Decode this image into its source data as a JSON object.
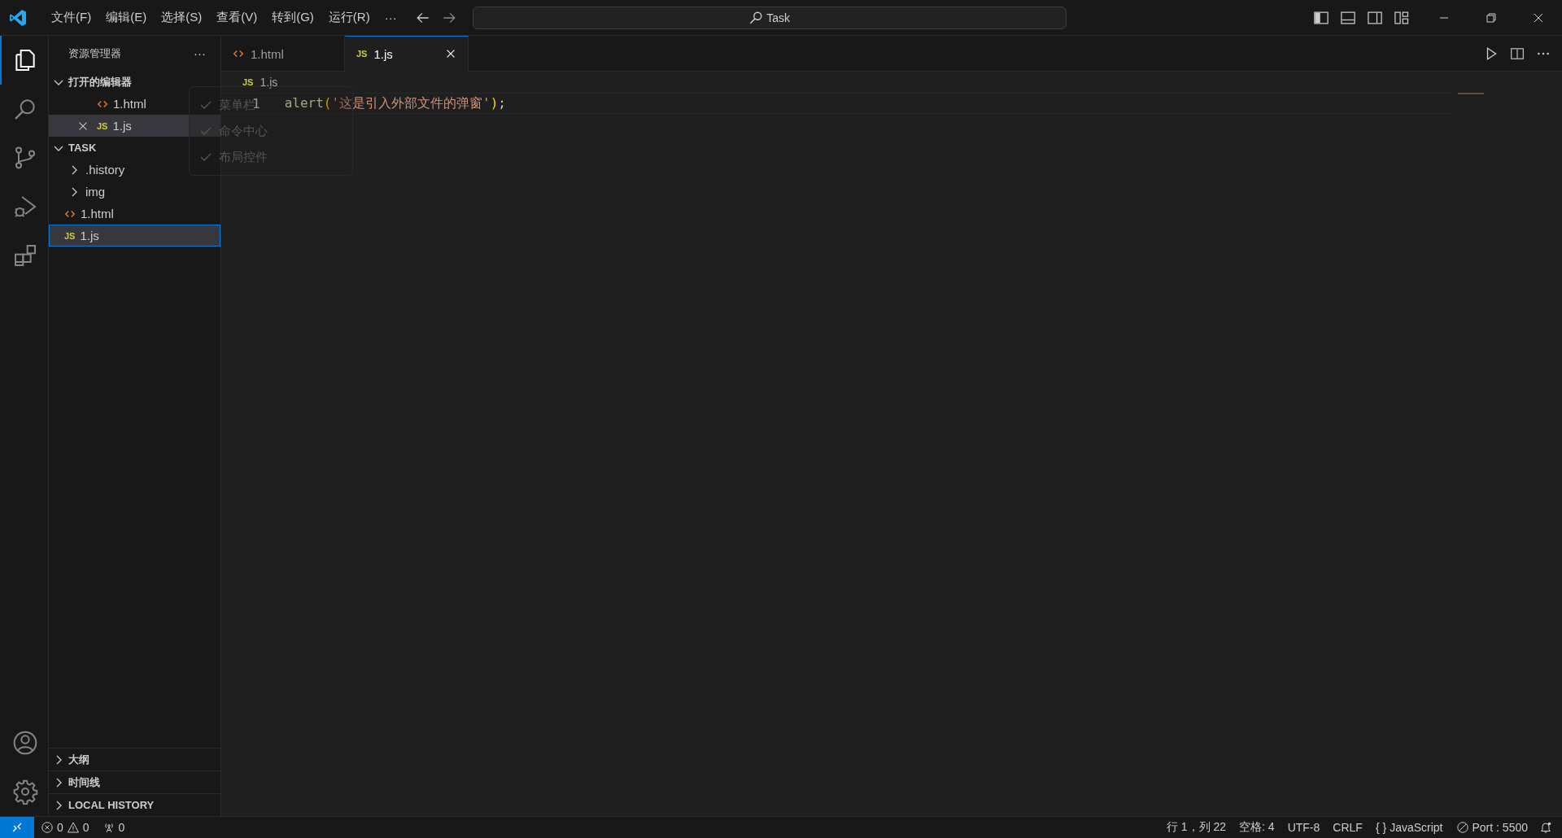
{
  "menu_bar": {
    "items": [
      "文件(F)",
      "编辑(E)",
      "选择(S)",
      "查看(V)",
      "转到(G)",
      "运行(R)"
    ],
    "overflow": "···"
  },
  "command_center": {
    "text": "Task"
  },
  "activity_bar": {
    "top": [
      {
        "kind": "explorer",
        "selected": true
      },
      {
        "kind": "search",
        "selected": false
      },
      {
        "kind": "source-control",
        "selected": false
      },
      {
        "kind": "run-debug",
        "selected": false
      },
      {
        "kind": "extensions",
        "selected": false
      }
    ],
    "bottom": [
      {
        "kind": "account"
      },
      {
        "kind": "settings"
      }
    ]
  },
  "sidebar": {
    "title": "资源管理器",
    "more": "···",
    "sections": [
      {
        "title": "打开的编辑器",
        "expanded": true,
        "items": [
          {
            "name": "1.html",
            "kind": "html",
            "selected": false,
            "closable": false
          },
          {
            "name": "1.js",
            "kind": "js",
            "badge": "JS",
            "selected": true,
            "closable": true
          }
        ]
      },
      {
        "title": "TASK",
        "expanded": true,
        "items": [
          {
            "name": ".history",
            "kind": "folder",
            "expanded": false,
            "selected": false
          },
          {
            "name": "img",
            "kind": "folder",
            "expanded": false,
            "selected": false
          },
          {
            "name": "1.html",
            "kind": "html",
            "selected": false
          },
          {
            "name": "1.js",
            "kind": "js",
            "badge": "JS",
            "selected": true
          }
        ]
      }
    ],
    "bottom_sections": [
      {
        "title": "大纲",
        "expanded": false
      },
      {
        "title": "时间线",
        "expanded": false
      },
      {
        "title": "LOCAL HISTORY",
        "expanded": false
      }
    ]
  },
  "tabs": [
    {
      "label": "1.html",
      "kind": "html",
      "selected": false
    },
    {
      "label": "1.js",
      "kind": "js",
      "badge": "JS",
      "selected": true
    }
  ],
  "breadcrumb": {
    "label": "1.js",
    "kind": "js",
    "badge": "JS"
  },
  "code": [
    {
      "number": "1",
      "tokens": [
        {
          "kind": "function",
          "text": "alert"
        },
        {
          "kind": "bracket",
          "text": "("
        },
        {
          "kind": "string",
          "text": "'这是引入外部文件的弹窗'"
        },
        {
          "kind": "bracket",
          "text": ")"
        },
        {
          "kind": "punct",
          "text": ";"
        }
      ]
    }
  ],
  "layout_menu": {
    "items": [
      {
        "label": "菜单栏",
        "checked": true
      },
      {
        "label": "命令中心",
        "checked": true
      },
      {
        "label": "布局控件",
        "checked": true
      }
    ]
  },
  "status_bar": {
    "errors": "0",
    "warnings": "0",
    "ports": "0",
    "right": [
      {
        "kind": "text",
        "text": "行 1，列 22"
      },
      {
        "kind": "text",
        "text": "空格: 4"
      },
      {
        "kind": "text",
        "text": "UTF-8"
      },
      {
        "kind": "text",
        "text": "CRLF"
      },
      {
        "kind": "language",
        "icon": "{ }",
        "text": "JavaScript"
      },
      {
        "kind": "port",
        "text": "Port : 5500"
      },
      {
        "kind": "bell"
      }
    ]
  }
}
